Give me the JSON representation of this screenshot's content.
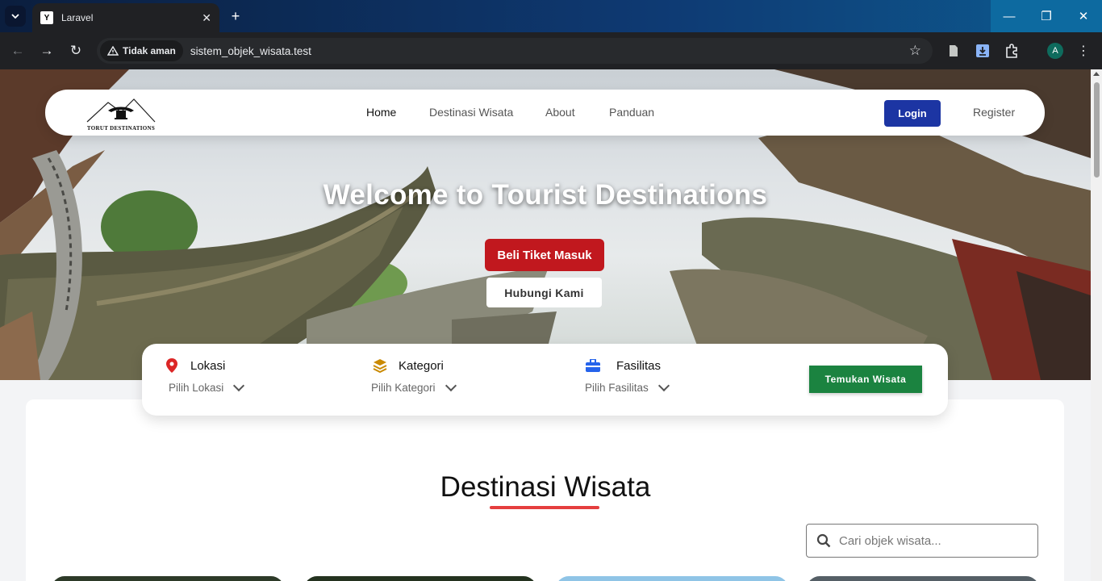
{
  "browser": {
    "tab_title": "Laravel",
    "tab_favicon": "Y",
    "security_label": "Tidak aman",
    "url": "sistem_objek_wisata.test",
    "profile_initial": "A"
  },
  "navbar": {
    "logo_text": "TORUT DESTINATIONS",
    "links": [
      "Home",
      "Destinasi Wisata",
      "About",
      "Panduan"
    ],
    "login_label": "Login",
    "register_label": "Register"
  },
  "hero": {
    "title": "Welcome to Tourist Destinations",
    "ticket_button": "Beli Tiket Masuk",
    "contact_button": "Hubungi Kami"
  },
  "filters": {
    "location": {
      "label": "Lokasi",
      "placeholder": "Pilih Lokasi",
      "icon": "map-pin-icon",
      "color": "#dc2626"
    },
    "category": {
      "label": "Kategori",
      "placeholder": "Pilih Kategori",
      "icon": "layers-icon",
      "color": "#ca8a04"
    },
    "facility": {
      "label": "Fasilitas",
      "placeholder": "Pilih Fasilitas",
      "icon": "toolbox-icon",
      "color": "#2563eb"
    },
    "submit_label": "Temukan Wisata"
  },
  "section": {
    "title": "Destinasi Wisata",
    "search_placeholder": "Cari objek wisata..."
  },
  "colors": {
    "primary": "#1c35a3",
    "danger": "#c1181e",
    "success": "#1b8340",
    "accent_underline": "#e53e3e"
  }
}
